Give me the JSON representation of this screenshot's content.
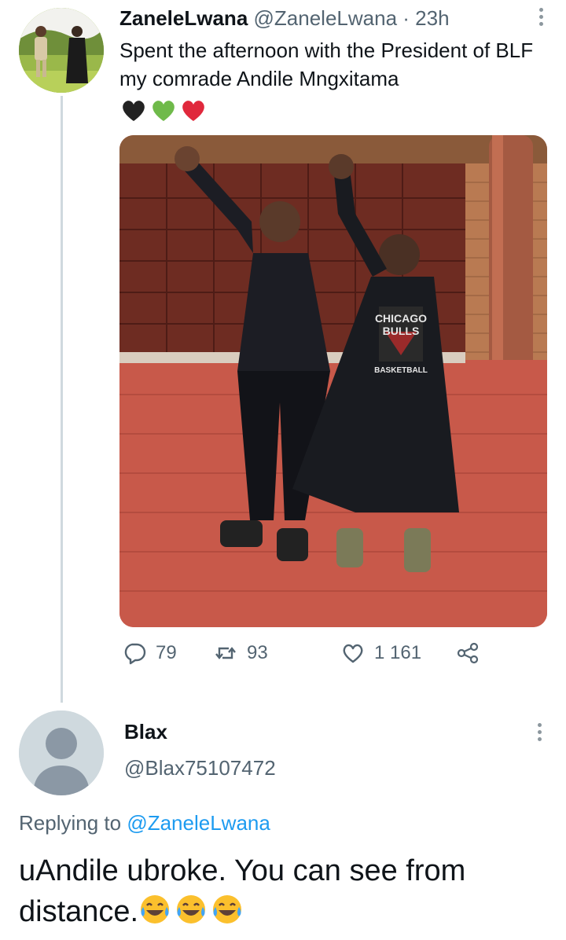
{
  "tweet": {
    "author_name": "ZaneleLwana",
    "author_handle": "@ZaneleLwana",
    "separator": "·",
    "time": "23h",
    "text": "Spent the afternoon with the President of BLF my comrade Andile Mngxitama",
    "emoji": [
      "black-heart",
      "green-heart",
      "red-heart"
    ],
    "photo_text": [
      "CHICAGO",
      "BULLS",
      "BASKETBALL"
    ],
    "stats": {
      "replies": "79",
      "retweets": "93",
      "likes": "1 161"
    }
  },
  "reply": {
    "author_name": "Blax",
    "author_handle": "@Blax75107472",
    "replying_prefix": "Replying to",
    "replying_to": "@ZaneleLwana",
    "text": "uAndile ubroke. You can see from distance.",
    "emoji": [
      "face-with-tears-of-joy",
      "face-with-tears-of-joy",
      "face-with-tears-of-joy"
    ]
  },
  "colors": {
    "text_primary": "#0f1419",
    "text_secondary": "#536471",
    "link": "#1d9bf0",
    "thread_line": "#cfd9de"
  }
}
